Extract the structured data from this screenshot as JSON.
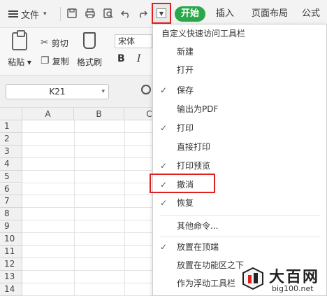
{
  "topbar": {
    "file_menu": "文件",
    "tabs": [
      "开始",
      "插入",
      "页面布局",
      "公式"
    ],
    "accent": "#2aa748",
    "highlight_color": "#e02020"
  },
  "ribbon": {
    "paste": "粘贴",
    "cut": "剪切",
    "copy": "复制",
    "format_painter": "格式刷",
    "font_name": "宋体",
    "bold": "B",
    "italic": "I"
  },
  "formula_bar": {
    "name_box": "K21"
  },
  "sheet": {
    "columns": [
      "A",
      "B",
      "C"
    ],
    "rows": [
      "1",
      "2",
      "3",
      "4",
      "5",
      "6",
      "7",
      "8",
      "9",
      "10",
      "11",
      "12",
      "13",
      "14"
    ]
  },
  "qat_menu": {
    "title": "自定义快速访问工具栏",
    "items": [
      {
        "label": "新建",
        "checked": false
      },
      {
        "label": "打开",
        "checked": false
      },
      {
        "label": "保存",
        "checked": true
      },
      {
        "label": "输出为PDF",
        "checked": false
      },
      {
        "label": "打印",
        "checked": true
      },
      {
        "label": "直接打印",
        "checked": false
      },
      {
        "label": "打印预览",
        "checked": true
      },
      {
        "label": "撤消",
        "checked": true
      },
      {
        "label": "恢复",
        "checked": true
      }
    ],
    "more_commands": "其他命令...",
    "position_items": [
      {
        "label": "放置在顶端",
        "checked": true
      },
      {
        "label": "放置在功能区之下",
        "checked": false
      },
      {
        "label": "作为浮动工具栏",
        "checked": false
      }
    ],
    "check_glyph": "✓"
  },
  "watermark": {
    "name": "大百网",
    "url": "big100.net"
  }
}
